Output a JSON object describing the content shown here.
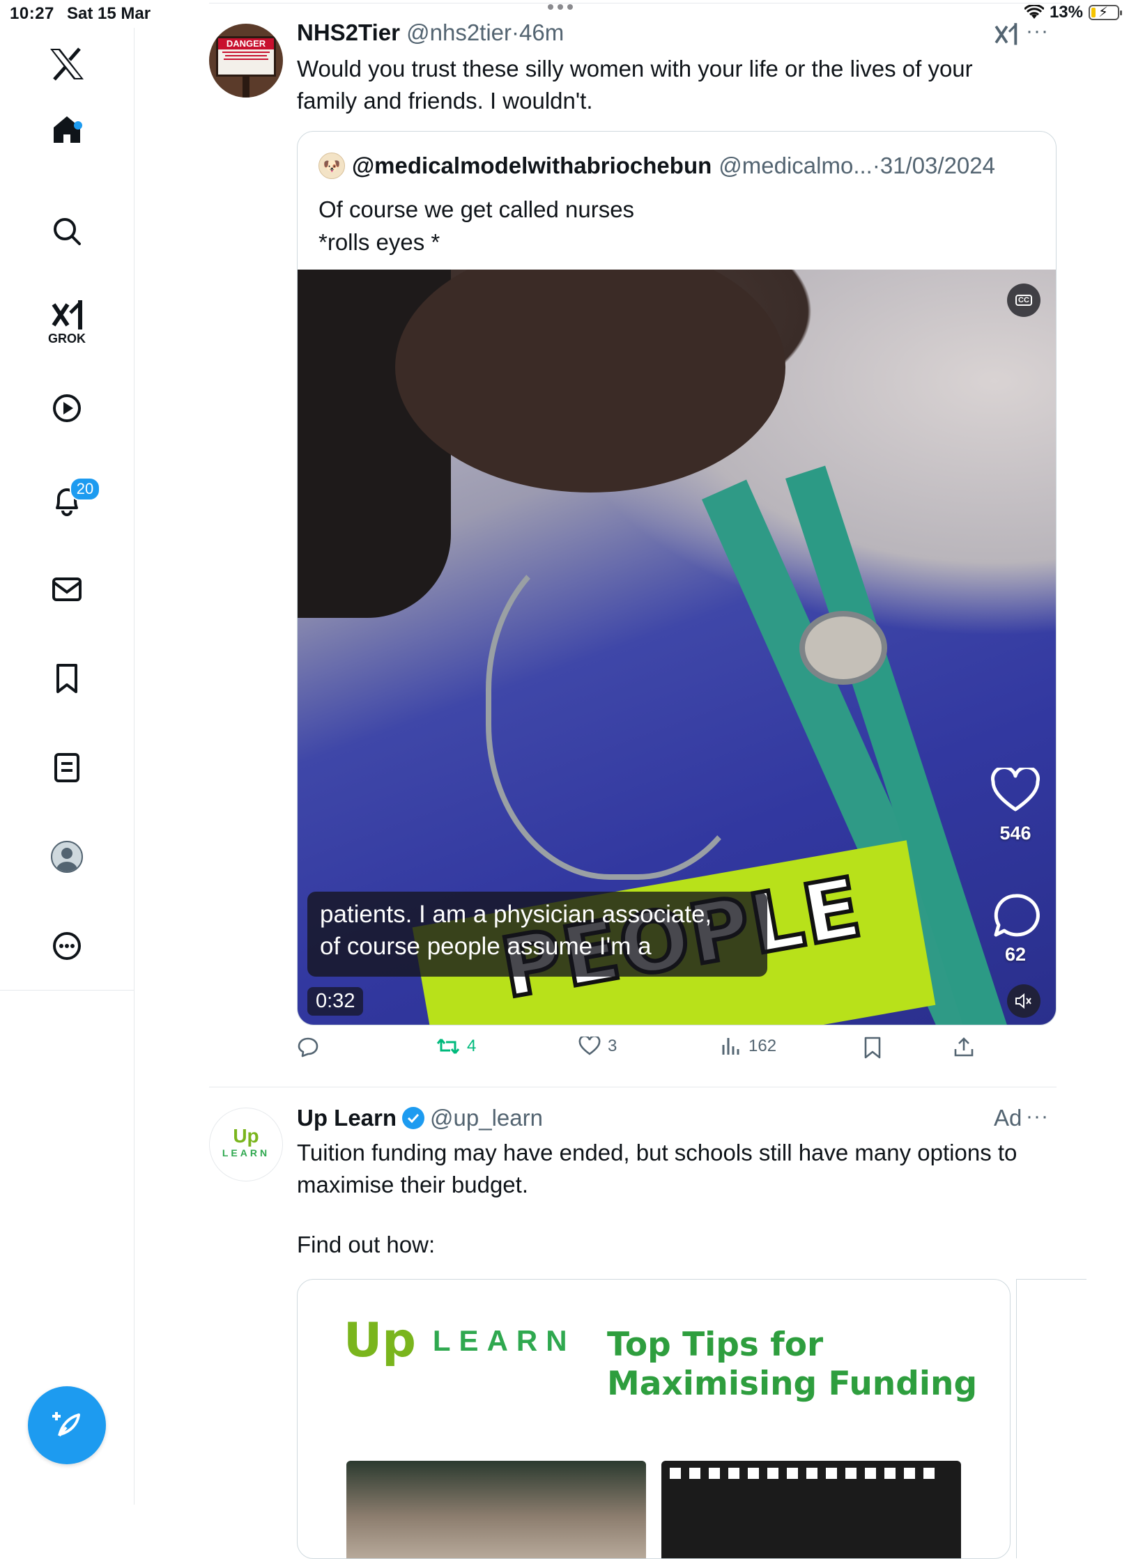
{
  "status_bar": {
    "time": "10:27",
    "date": "Sat 15 Mar",
    "battery_percent": "13%"
  },
  "sidebar": {
    "items": [
      {
        "name": "logo",
        "icon": "x-logo-icon"
      },
      {
        "name": "home",
        "icon": "home-icon"
      },
      {
        "name": "search",
        "icon": "search-icon"
      },
      {
        "name": "grok",
        "icon": "grok-icon",
        "label": "GROK"
      },
      {
        "name": "video",
        "icon": "play-icon"
      },
      {
        "name": "notifications",
        "icon": "bell-icon",
        "badge": "20"
      },
      {
        "name": "messages",
        "icon": "mail-icon"
      },
      {
        "name": "bookmarks",
        "icon": "bookmark-icon"
      },
      {
        "name": "lists",
        "icon": "list-icon"
      },
      {
        "name": "profile",
        "icon": "avatar-icon"
      },
      {
        "name": "more",
        "icon": "more-circle-icon"
      }
    ],
    "compose_icon": "compose-icon"
  },
  "tweet1": {
    "name": "NHS2Tier",
    "handle": "@nhs2tier",
    "dot": "·",
    "time": "46m",
    "body": "Would you trust these silly women with your life or the lives of your family and friends. I wouldn't.",
    "avatar_text": "DANGER",
    "avatar_subtext": "AUTHORIZED PERSONNEL ONLY BEYOND THIS POINT",
    "quote": {
      "name": "@medicalmodelwithabriochebun",
      "handle": "@medicalmo...",
      "dot": "·",
      "date": "31/03/2024",
      "line1": "Of course we get called nurses",
      "line2": "*rolls eyes *",
      "video": {
        "caption_line1": "patients. I am a physician associate,",
        "caption_line2": "of course people assume I'm a",
        "overlay_text": "PEOPLE",
        "timestamp": "0:32",
        "likes": "546",
        "comments": "62",
        "cc_label": "CC"
      }
    },
    "actions": {
      "retweets": "4",
      "likes": "3",
      "views": "162"
    }
  },
  "tweet2": {
    "name": "Up Learn",
    "handle": "@up_learn",
    "ad_label": "Ad",
    "body": "Tuition funding may have ended, but schools still have many options to maximise their budget.",
    "find_out": "Find out how:",
    "avatar_up": "Up",
    "avatar_learn": "LEARN",
    "card": {
      "logo_up": "Up",
      "logo_learn": "LEARN",
      "title_line1": "Top Tips for",
      "title_line2": "Maximising Funding"
    }
  },
  "colors": {
    "accent": "#1d9bf0",
    "retweet_green": "#00ba7c",
    "muted": "#536471",
    "uplearn_green": "#2e9e3e"
  }
}
